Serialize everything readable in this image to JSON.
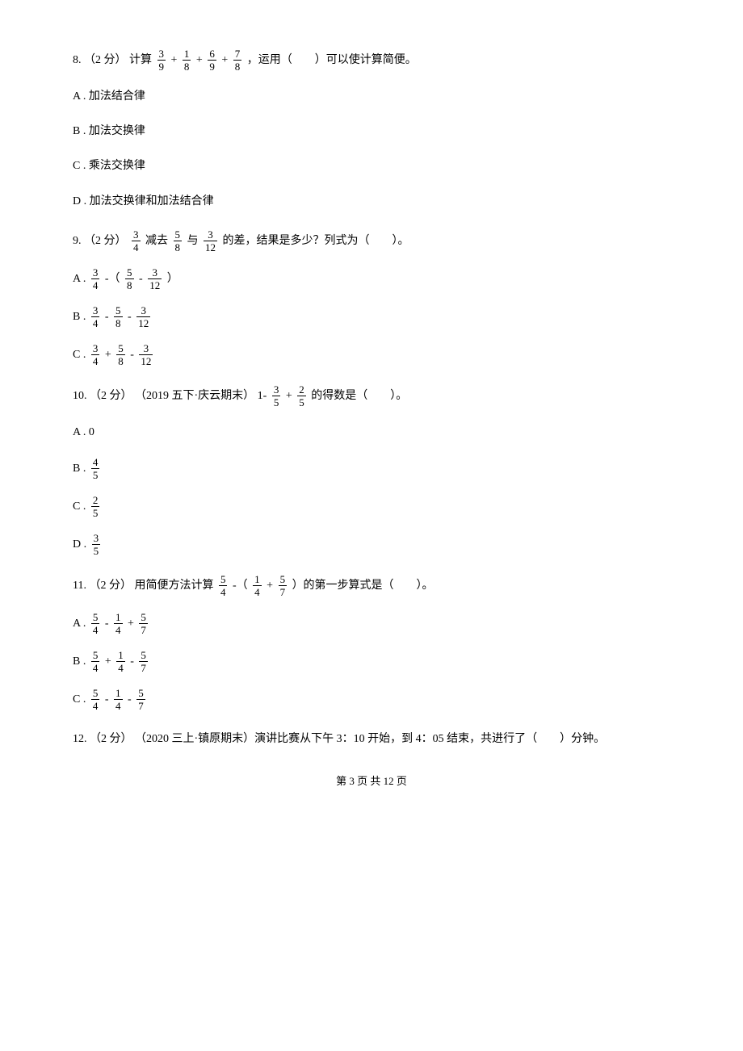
{
  "q8": {
    "num": "8. （2 分） 计算 ",
    "f1n": "3",
    "f1d": "9",
    "f2n": "1",
    "f2d": "8",
    "f3n": "6",
    "f3d": "9",
    "f4n": "7",
    "f4d": "8",
    "tail": " ，运用（　　）可以使计算简便。",
    "optA": "A . 加法结合律",
    "optB": "B . 加法交换律",
    "optC": "C . 乘法交换律",
    "optD": "D . 加法交换律和加法结合律",
    "plus": " + "
  },
  "q9": {
    "num": "9. （2 分） ",
    "f1n": "3",
    "f1d": "4",
    "mid1": " 减去 ",
    "f2n": "5",
    "f2d": "8",
    "mid2": " 与 ",
    "f3n": "3",
    "f3d": "12",
    "tail": " 的差，结果是多少？列式为（　　）。",
    "optA_pre": "A . ",
    "optA_mid": " -（ ",
    "optA_end": " ）",
    "optB_pre": "B . ",
    "optC_pre": "C . ",
    "minus": " - ",
    "plus": " + "
  },
  "q10": {
    "num": "10. （2 分） （2019 五下·庆云期末） ",
    "expr_pre": "1- ",
    "f1n": "3",
    "f1d": "5",
    "f2n": "2",
    "f2d": "5",
    "tail": " 的得数是（　　）。",
    "optA": "A . 0",
    "optB_pre": "B . ",
    "optBn": "4",
    "optBd": "5",
    "optC_pre": "C . ",
    "optCn": "2",
    "optCd": "5",
    "optD_pre": "D . ",
    "optDn": "3",
    "optDd": "5",
    "plus": " + "
  },
  "q11": {
    "num": "11. （2 分） 用简便方法计算 ",
    "f1n": "5",
    "f1d": "4",
    "mid1": " -（ ",
    "f2n": "1",
    "f2d": "4",
    "mid2": " + ",
    "f3n": "5",
    "f3d": "7",
    "tail": " ）的第一步算式是（　　）。",
    "optA_pre": "A . ",
    "optB_pre": "B . ",
    "optC_pre": "C . ",
    "minus": " - ",
    "plus": " + "
  },
  "q12": {
    "text": "12. （2 分） （2020 三上·镇原期末）演讲比赛从下午 3：10 开始，到 4：05 结束，共进行了（　　）分钟。"
  },
  "footer": "第 3 页 共 12 页"
}
